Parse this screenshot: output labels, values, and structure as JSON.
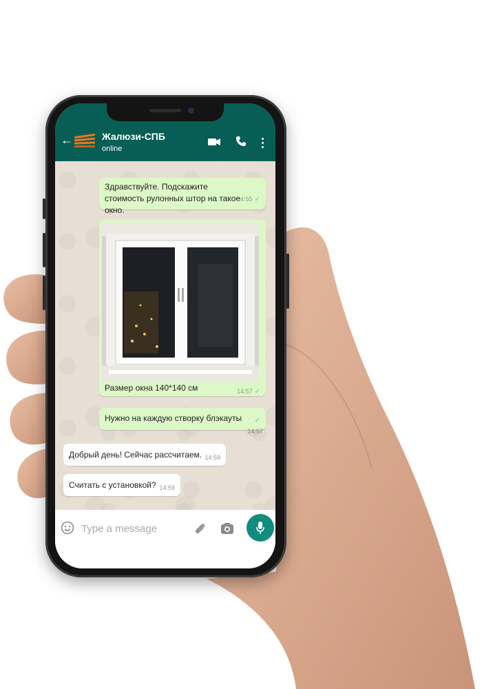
{
  "colors": {
    "header": "#075e54",
    "outgoing": "#dcf8c6",
    "incoming": "#ffffff",
    "mic": "#128c7e",
    "logo": "#e8781f"
  },
  "header": {
    "back_icon": "arrow-left-icon",
    "contact_name": "Жалюзи-СПБ",
    "status": "online",
    "icons": [
      "video-call-icon",
      "phone-call-icon",
      "menu-dots-icon"
    ]
  },
  "messages": [
    {
      "direction": "out",
      "text": "Здравствуйте. Подскажите стоимость рулонных штор на такое окно.",
      "time": "14:55",
      "read": true
    },
    {
      "direction": "out",
      "type": "image",
      "caption": "Размер окна 140*140 см",
      "time": "14:57",
      "read": true
    },
    {
      "direction": "out",
      "text": "Нужно на каждую створку блэкауты",
      "time": "14:57",
      "read": true
    },
    {
      "direction": "in",
      "text": "Добрый день! Сейчас рассчитаем.",
      "time": "14:59"
    },
    {
      "direction": "in",
      "text": "Считать с установкой?",
      "time": "14:59"
    }
  ],
  "input": {
    "placeholder": "Type a message",
    "value": ""
  },
  "input_icons": [
    "emoji-icon",
    "attach-icon",
    "camera-icon",
    "mic-icon"
  ]
}
